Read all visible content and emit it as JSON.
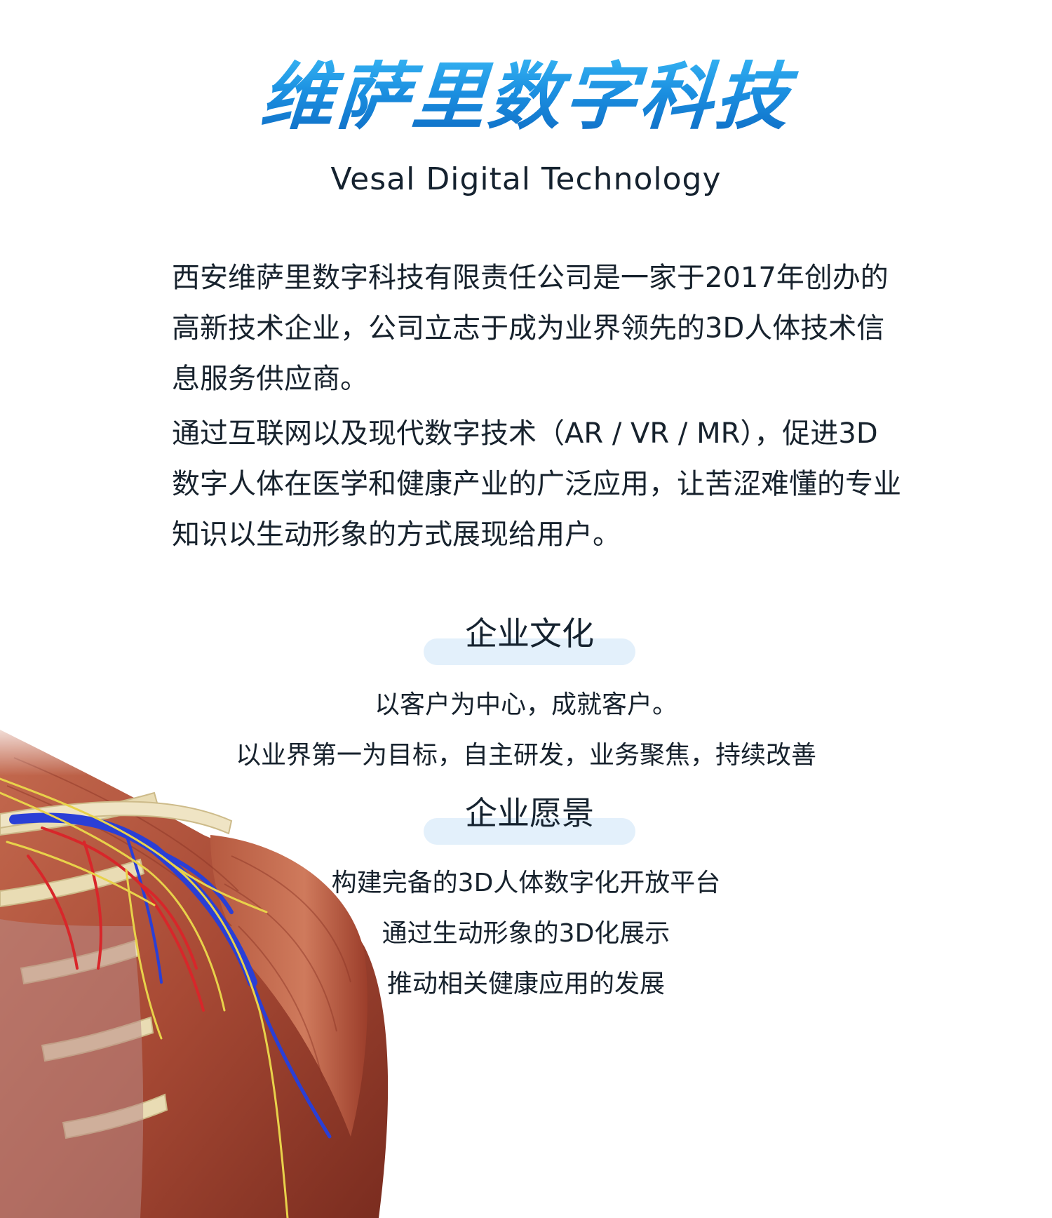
{
  "brand": {
    "title": "维萨里数字科技",
    "subtitle": "Vesal Digital Technology",
    "colors": {
      "title_light": "#36b4f3",
      "title_dark": "#0e6cc4",
      "text": "#17222d",
      "pill": "#e3f0fb"
    }
  },
  "intro": {
    "paragraphs": [
      "西安维萨里数字科技有限责任公司是一家于2017年创办的高新技术企业，公司立志于成为业界领先的3D人体技术信息服务供应商。",
      "通过互联网以及现代数字技术（AR / VR / MR），促进3D数字人体在医学和健康产业的广泛应用，让苦涩难懂的专业知识以生动形象的方式展现给用户。"
    ]
  },
  "culture": {
    "heading": "企业文化",
    "lines": [
      "以客户为中心，成就客户。",
      "以业界第一为目标，自主研发，业务聚焦，持续改善"
    ]
  },
  "vision": {
    "heading": "企业愿景",
    "lines": [
      "构建完备的3D人体数字化开放平台",
      "通过生动形象的3D化展示",
      "推动相关健康应用的发展"
    ]
  },
  "illustration": {
    "subject": "3d-anatomy-shoulder-illustration"
  }
}
